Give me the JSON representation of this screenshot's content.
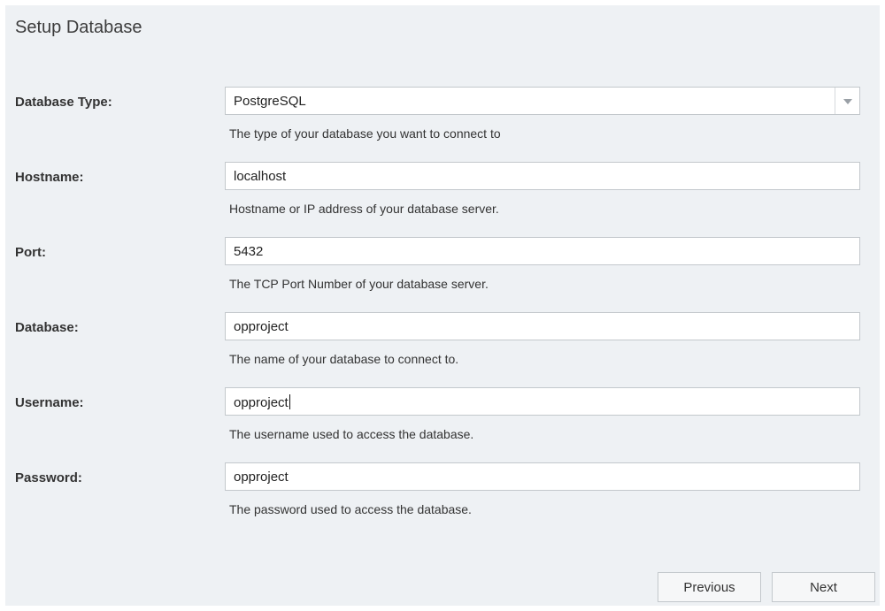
{
  "page": {
    "title": "Setup Database"
  },
  "fields": {
    "db_type": {
      "label": "Database Type:",
      "value": "PostgreSQL",
      "hint": "The type of your database you want to connect to"
    },
    "hostname": {
      "label": "Hostname:",
      "value": "localhost",
      "hint": "Hostname or IP address of your database server."
    },
    "port": {
      "label": "Port:",
      "value": "5432",
      "hint": "The TCP Port Number of your database server."
    },
    "database": {
      "label": "Database:",
      "value": "opproject",
      "hint": "The name of your database to connect to."
    },
    "username": {
      "label": "Username:",
      "value": "opproject",
      "hint": "The username used to access the database."
    },
    "password": {
      "label": "Password:",
      "value": "opproject",
      "hint": "The password used to access the database."
    }
  },
  "buttons": {
    "previous": "Previous",
    "next": "Next"
  },
  "icons": {
    "select_arrow": "chevron-down-icon"
  }
}
